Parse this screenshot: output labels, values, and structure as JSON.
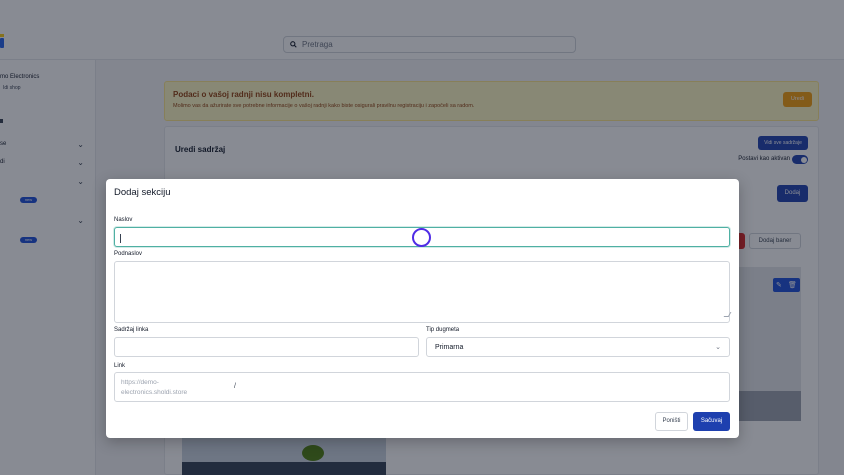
{
  "search": {
    "placeholder": "Pretraga"
  },
  "sidebar": {
    "shop_name": "mo Electronics",
    "shop_link": "Idi shop",
    "rows": [
      {
        "label": "se"
      },
      {
        "label": "di"
      }
    ],
    "badge": "new"
  },
  "alert": {
    "title": "Podaci o vašoj radnji nisu kompletni.",
    "text": "Molimo vas da ažurirate sve potrebne informacije o vašoj radnji kako biste osigurali pravilnu registraciju i započeli sa radom.",
    "button": "Uredi"
  },
  "card": {
    "title": "Uredi sadržaj",
    "view_all_button": "Vidi sve sadržaje",
    "active_label": "Postavi kao aktivan",
    "add_button": "Dodaj",
    "add_banner_button": "Dodaj baner"
  },
  "modal": {
    "title": "Dodaj sekciju",
    "fields": {
      "naslov_label": "Naslov",
      "naslov_value": "",
      "podnaslov_label": "Podnaslov",
      "podnaslov_value": "",
      "link_content_label": "Sadržaj linka",
      "link_content_value": "",
      "button_type_label": "Tip dugmeta",
      "button_type_value": "Primarna",
      "link_label": "Link",
      "link_prefix": "https://demo-electronics.sholdi.store",
      "link_suffix": "/"
    },
    "cancel_button": "Poništi",
    "save_button": "Sačuvaj"
  },
  "colors": {
    "primary": "#1e40af",
    "alert_bg": "#fef9c3",
    "alert_button": "#f59e0b",
    "focus_border": "#4fb0a3",
    "cursor_ring": "#4f2ce6"
  }
}
